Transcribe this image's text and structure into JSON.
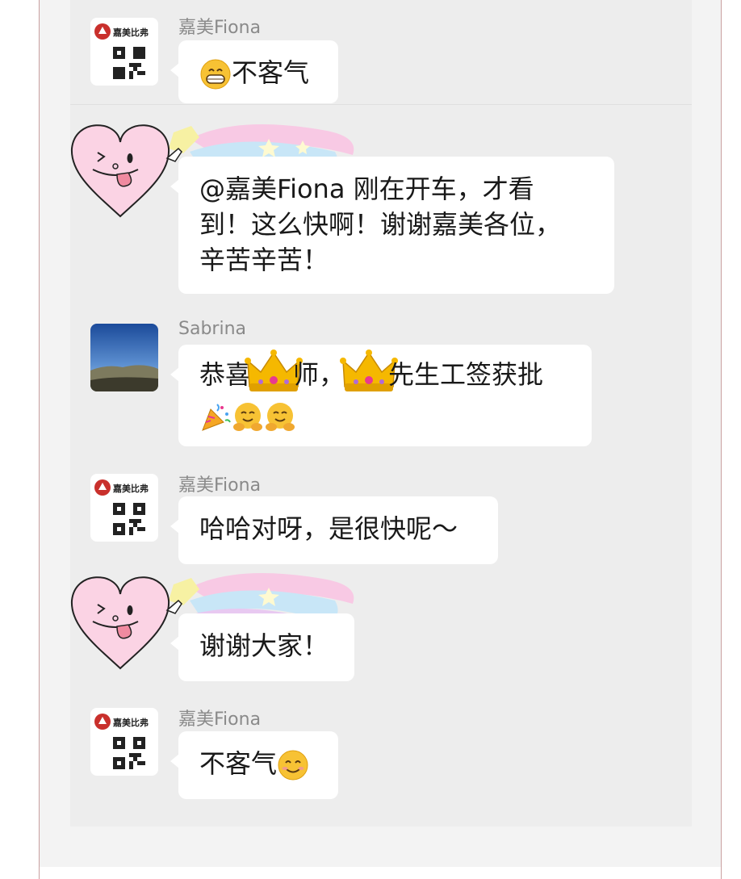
{
  "messages": [
    {
      "sender": "嘉美Fiona",
      "text": "不客气"
    },
    {
      "sender": "",
      "text_lines": [
        "@嘉美Fiona 刚在开车，才看",
        "到！这么快啊！谢谢嘉美各位，",
        "辛苦辛苦！"
      ]
    },
    {
      "sender": "Sabrina",
      "text_parts": [
        "恭喜",
        "师，",
        "先生工签获批"
      ]
    },
    {
      "sender": "嘉美Fiona",
      "text": "哈哈对呀，是很快呢～"
    },
    {
      "sender": "",
      "text": "谢谢大家！"
    },
    {
      "sender": "嘉美Fiona",
      "text": "不客气"
    }
  ],
  "logo_text": "嘉美比弗",
  "icons": [
    "grin-emoji",
    "crown-emoji",
    "party-popper-emoji",
    "hug-emoji",
    "smile-emoji",
    "heart-sticker",
    "qr-code-icon"
  ]
}
